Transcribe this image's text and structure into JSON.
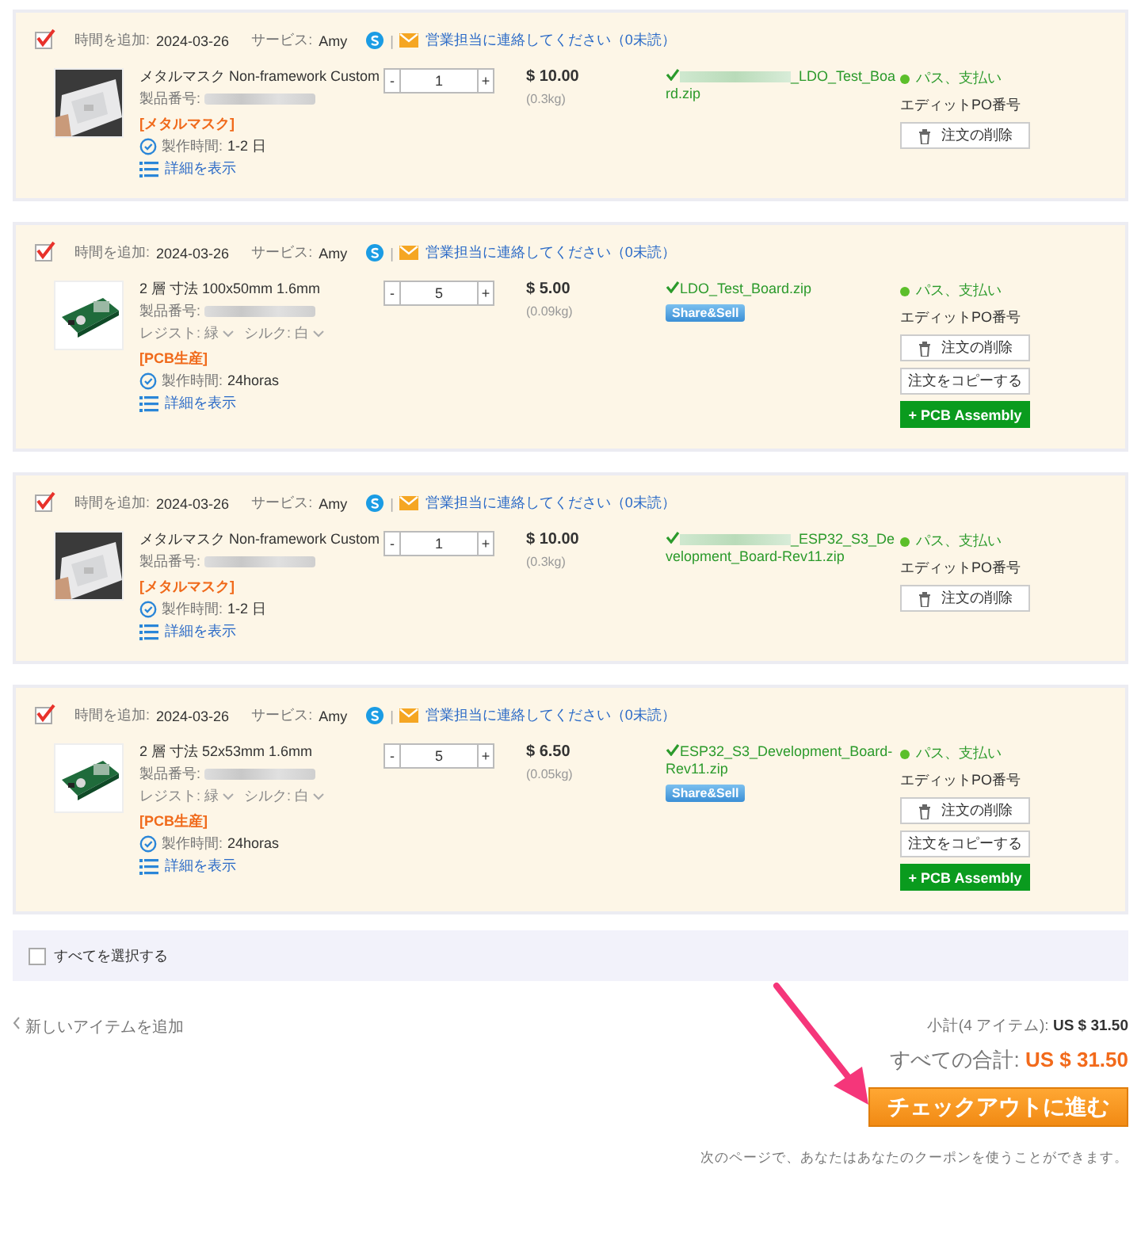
{
  "items": [
    {
      "checked": true,
      "added_label": "時間を追加:",
      "added_date": "2024-03-26",
      "service_label": "サービス:",
      "service_name": "Amy",
      "contact": "営業担当に連絡してください（0未読）",
      "kind": "stencil",
      "product_name": "メタルマスク Non-framework Custom",
      "part_label": "製品番号:",
      "category": "[メタルマスク]",
      "lead_label": "製作時間:",
      "lead_value": "1-2 日",
      "details": "詳細を表示",
      "qty": "1",
      "price": "$ 10.00",
      "weight": "(0.3kg)",
      "file": "_LDO_Test_Board.zip",
      "file_redacted": true,
      "status": "パス、支払い",
      "po": "エディットPO番号",
      "buttons": [
        {
          "kind": "delete",
          "label": "注文の削除"
        }
      ]
    },
    {
      "checked": true,
      "added_label": "時間を追加:",
      "added_date": "2024-03-26",
      "service_label": "サービス:",
      "service_name": "Amy",
      "contact": "営業担当に連絡してください（0未読）",
      "kind": "pcb",
      "product_name": "2 層 寸法 100x50mm 1.6mm",
      "part_label": "製品番号:",
      "options": [
        "レジスト: 緑",
        "シルク: 白"
      ],
      "category": "[PCB生産]",
      "lead_label": "製作時間:",
      "lead_value": "24horas",
      "details": "詳細を表示",
      "qty": "5",
      "price": "$ 5.00",
      "weight": "(0.09kg)",
      "file": "LDO_Test_Board.zip",
      "file_redacted": false,
      "badge": "Share&Sell",
      "status": "パス、支払い",
      "po": "エディットPO番号",
      "buttons": [
        {
          "kind": "delete",
          "label": "注文の削除"
        },
        {
          "kind": "copy",
          "label": "注文をコピーする"
        },
        {
          "kind": "assembly",
          "label": "+ PCB Assembly"
        }
      ]
    },
    {
      "checked": true,
      "added_label": "時間を追加:",
      "added_date": "2024-03-26",
      "service_label": "サービス:",
      "service_name": "Amy",
      "contact": "営業担当に連絡してください（0未読）",
      "kind": "stencil",
      "product_name": "メタルマスク Non-framework Custom",
      "part_label": "製品番号:",
      "category": "[メタルマスク]",
      "lead_label": "製作時間:",
      "lead_value": "1-2 日",
      "details": "詳細を表示",
      "qty": "1",
      "price": "$ 10.00",
      "weight": "(0.3kg)",
      "file": "_ESP32_S3_Development_Board-Rev11.zip",
      "file_redacted": true,
      "status": "パス、支払い",
      "po": "エディットPO番号",
      "buttons": [
        {
          "kind": "delete",
          "label": "注文の削除"
        }
      ]
    },
    {
      "checked": true,
      "added_label": "時間を追加:",
      "added_date": "2024-03-26",
      "service_label": "サービス:",
      "service_name": "Amy",
      "contact": "営業担当に連絡してください（0未読）",
      "kind": "pcb",
      "product_name": "2 層 寸法 52x53mm 1.6mm",
      "part_label": "製品番号:",
      "options": [
        "レジスト: 緑",
        "シルク: 白"
      ],
      "category": "[PCB生産]",
      "lead_label": "製作時間:",
      "lead_value": "24horas",
      "details": "詳細を表示",
      "qty": "5",
      "price": "$ 6.50",
      "weight": "(0.05kg)",
      "file": "ESP32_S3_Development_Board-Rev11.zip",
      "file_redacted": false,
      "badge": "Share&Sell",
      "status": "パス、支払い",
      "po": "エディットPO番号",
      "buttons": [
        {
          "kind": "delete",
          "label": "注文の削除"
        },
        {
          "kind": "copy",
          "label": "注文をコピーする"
        },
        {
          "kind": "assembly",
          "label": "+ PCB Assembly"
        }
      ]
    }
  ],
  "separator": "|",
  "minus": "-",
  "plus": "+",
  "select_all": {
    "label": "すべてを選択する",
    "checked": false
  },
  "add_item": "新しいアイテムを追加",
  "subtotal_label": "小計(4 アイテム):",
  "subtotal": "US $ 31.50",
  "total_label": "すべての合計:",
  "total": "US $ 31.50",
  "checkout": "チェックアウトに進む",
  "coupon_note": "次のページで、あなたはあなたのクーポンを使うことができます。"
}
